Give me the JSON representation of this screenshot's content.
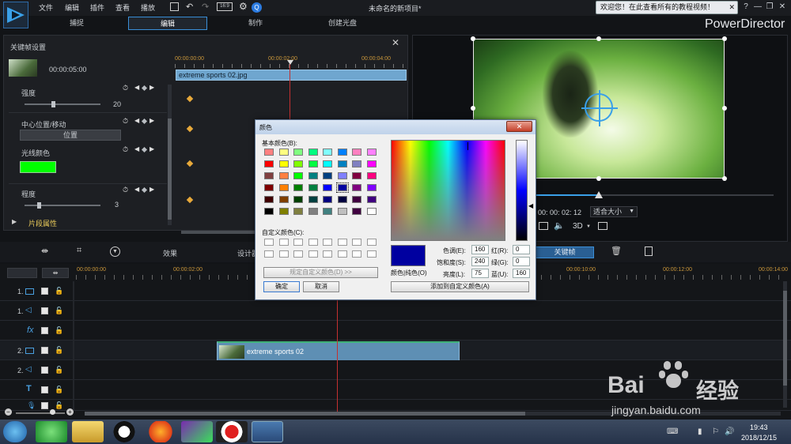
{
  "menu": {
    "file": "文件",
    "edit": "编辑",
    "plugins": "插件",
    "view": "查看",
    "playback": "播放"
  },
  "project_title": "未命名的新项目*",
  "banner": "欢迎您！在此查看所有的教程视频！",
  "tabs": {
    "capture": "捕捉",
    "edit": "编辑",
    "produce": "制作",
    "disc": "创建光盘"
  },
  "brand": "PowerDirector",
  "kf": {
    "title": "关键帧设置",
    "duration": "00:00:05:00",
    "ruler": [
      "00:00:00:00",
      "00:00:02:00",
      "00:00:04:00"
    ],
    "clip": "extreme sports 02.jpg",
    "strength": "强度",
    "strength_val": "20",
    "center": "中心位置/移动",
    "position_btn": "位置",
    "color": "光线颜色",
    "color_hex": "#00ff00",
    "degree": "程度",
    "degree_val": "3",
    "clip_props": "片段属性"
  },
  "preview": {
    "timecode": "00: 00: 02: 12",
    "fit": "适合大小",
    "mode3d": "3D"
  },
  "toolbar": {
    "effects": "效果",
    "design": "设计器",
    "keyframe": "关键帧"
  },
  "dialog": {
    "title": "颜色",
    "basic": "基本颜色(B):",
    "custom": "自定义颜色(C):",
    "define": "规定自定义颜色(D) >>",
    "ok": "确定",
    "cancel": "取消",
    "hue_l": "色调(E):",
    "hue": "160",
    "sat_l": "饱和度(S):",
    "sat": "240",
    "lum_l": "亮度(L):",
    "lum": "75",
    "red_l": "红(R):",
    "red": "0",
    "green_l": "绿(G):",
    "green": "0",
    "blue_l": "蓝(U):",
    "blue": "160",
    "colorsolid": "颜色|纯色(O)",
    "add": "添加到自定义颜色(A)",
    "current_hex": "#0000a0",
    "swatches": [
      [
        "#ff8080",
        "#ffff80",
        "#80ff80",
        "#00ff80",
        "#80ffff",
        "#0080ff",
        "#ff80c0",
        "#ff80ff"
      ],
      [
        "#ff0000",
        "#ffff00",
        "#80ff00",
        "#00ff40",
        "#00ffff",
        "#0080c0",
        "#8080c0",
        "#ff00ff"
      ],
      [
        "#804040",
        "#ff8040",
        "#00ff00",
        "#008080",
        "#004080",
        "#8080ff",
        "#800040",
        "#ff0080"
      ],
      [
        "#800000",
        "#ff8000",
        "#008000",
        "#008040",
        "#0000ff",
        "#0000a0",
        "#800080",
        "#8000ff"
      ],
      [
        "#400000",
        "#804000",
        "#004000",
        "#004040",
        "#000080",
        "#000040",
        "#400040",
        "#400080"
      ],
      [
        "#000000",
        "#808000",
        "#808040",
        "#808080",
        "#408080",
        "#c0c0c0",
        "#400040",
        "#ffffff"
      ]
    ]
  },
  "timeline": {
    "ruler": [
      "00:00:00:00",
      "00:00:02:00",
      "00:00:10:00",
      "00:00:12:00",
      "00:00:14:00"
    ],
    "tracks": [
      "1.",
      "1.",
      "fx",
      "2.",
      "2.",
      "T",
      ""
    ],
    "clip": "extreme sports 02"
  },
  "tray": {
    "time": "19:43",
    "date": "2018/12/15"
  },
  "watermark": {
    "brand": "Bai",
    "brand2": "经验",
    "url": "jingyan.baidu.com"
  }
}
